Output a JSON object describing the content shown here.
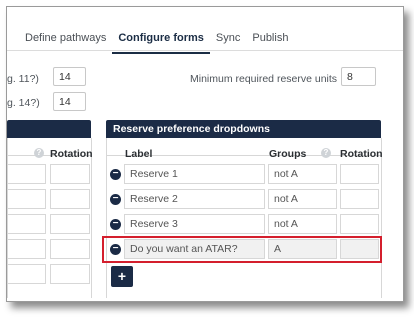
{
  "tabs": [
    {
      "label": "Define pathways",
      "active": false
    },
    {
      "label": "Configure forms",
      "active": true
    },
    {
      "label": "Sync",
      "active": false
    },
    {
      "label": "Publish",
      "active": false
    }
  ],
  "settings": {
    "field1_label": "g. 11?)",
    "field1_value": "14",
    "field2_label": "g. 14?)",
    "field2_value": "14",
    "min_reserve_label": "Minimum required reserve units",
    "min_reserve_value": "8"
  },
  "left_panel": {
    "rotation_header": "Rotation"
  },
  "right_panel": {
    "title": "Reserve preference dropdowns",
    "headers": {
      "label": "Label",
      "groups": "Groups",
      "rotation": "Rotation"
    },
    "rows": [
      {
        "label": "Reserve 1",
        "groups": "not A",
        "rotation": ""
      },
      {
        "label": "Reserve 2",
        "groups": "not A",
        "rotation": ""
      },
      {
        "label": "Reserve 3",
        "groups": "not A",
        "rotation": ""
      },
      {
        "label": "Do you want an ATAR?",
        "groups": "A",
        "rotation": ""
      }
    ],
    "add_label": "+"
  },
  "colors": {
    "accent": "#1b2b46",
    "highlight": "#d41f2d"
  }
}
